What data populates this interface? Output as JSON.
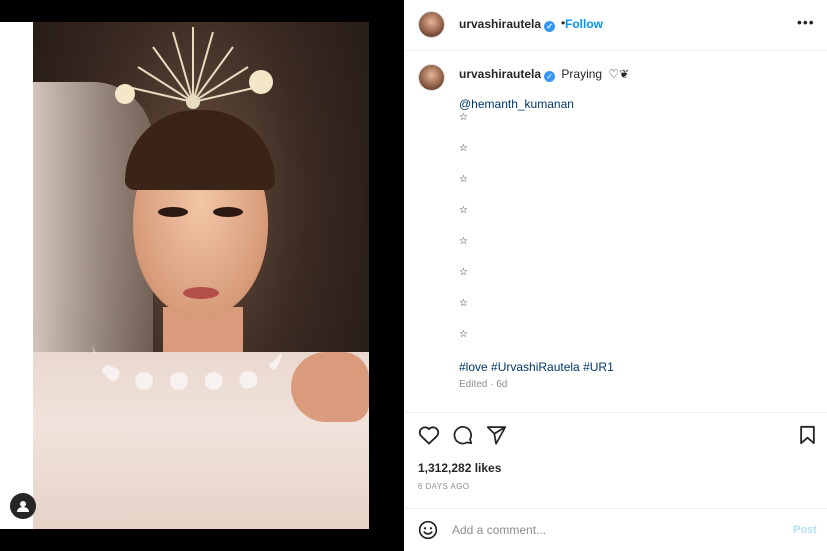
{
  "post": {
    "username": "urvashirautela",
    "follow_label": "Follow",
    "separator": "•",
    "more_icon": "more-options-icon",
    "caption_text": "Praying",
    "caption_emoji": "♡❦",
    "mention": "@hemanth_kumanan",
    "star_glyph": "☆",
    "star_count": 8,
    "hashtags": "#love #UrvashiRautela #UR1",
    "edited": "Edited · 6d",
    "likes": "1,312,282 likes",
    "date": "6 DAYS AGO",
    "comment_placeholder": "Add a comment...",
    "post_label": "Post"
  },
  "colors": {
    "link_blue": "#0095f6",
    "verified_blue": "#3897f0",
    "hashtag_blue": "#00376b",
    "muted": "#8e8e8e",
    "post_disabled": "#b2dffc"
  },
  "icons": [
    "heart-icon",
    "comment-icon",
    "share-icon",
    "bookmark-icon",
    "emoji-icon",
    "user-tag-icon",
    "verified-badge-icon"
  ]
}
